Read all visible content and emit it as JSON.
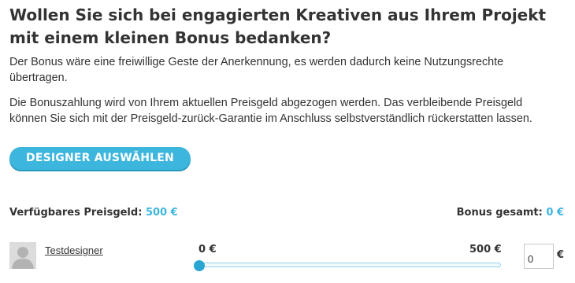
{
  "heading": "Wollen Sie sich bei engagierten Kreativen aus Ihrem Projekt mit einem kleinen Bonus bedanken?",
  "paragraphs": [
    "Der Bonus wäre eine freiwillige Geste der Anerkennung, es werden dadurch keine Nutzungsrechte übertragen.",
    "Die Bonuszahlung wird von Ihrem aktuellen Preisgeld abgezogen werden. Das verbleibende Preisgeld können Sie sich mit der Preisgeld-zurück-Garantie im Anschluss selbstverständlich rückerstatten lassen."
  ],
  "select_button_label": "DESIGNER AUSWÄHLEN",
  "available": {
    "label": "Verfügbares Preisgeld:",
    "value": "500 €"
  },
  "total": {
    "label": "Bonus gesamt:",
    "value": "0 €"
  },
  "designer": {
    "name": "Testdesigner",
    "avatar_icon": "user-silhouette-icon",
    "slider": {
      "min_label": "0 €",
      "max_label": "500 €",
      "min": 0,
      "max": 500,
      "value": 0
    },
    "amount": "0",
    "currency": "€"
  },
  "colors": {
    "accent": "#3db6de",
    "text": "#333333"
  }
}
